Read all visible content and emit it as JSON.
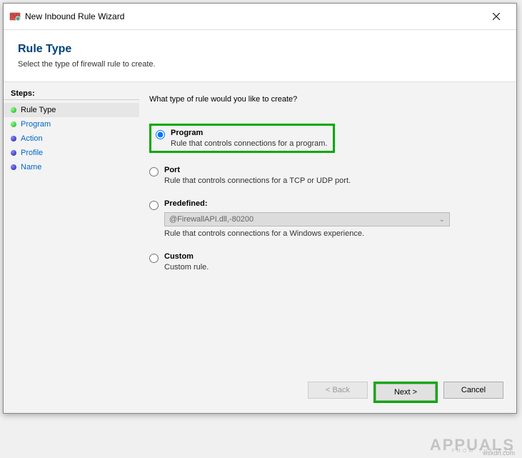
{
  "window": {
    "title": "New Inbound Rule Wizard"
  },
  "header": {
    "title": "Rule Type",
    "subtitle": "Select the type of firewall rule to create."
  },
  "sidebar": {
    "heading": "Steps:",
    "items": [
      {
        "label": "Rule Type",
        "bullet": "green",
        "current": true
      },
      {
        "label": "Program",
        "bullet": "green",
        "current": false,
        "link": true
      },
      {
        "label": "Action",
        "bullet": "blue",
        "current": false,
        "link": true
      },
      {
        "label": "Profile",
        "bullet": "blue",
        "current": false,
        "link": true
      },
      {
        "label": "Name",
        "bullet": "blue",
        "current": false,
        "link": true
      }
    ]
  },
  "content": {
    "prompt": "What type of rule would you like to create?",
    "options": {
      "program": {
        "label": "Program",
        "desc": "Rule that controls connections for a program."
      },
      "port": {
        "label": "Port",
        "desc": "Rule that controls connections for a TCP or UDP port."
      },
      "predefined": {
        "label": "Predefined:",
        "dropdown": "@FirewallAPI.dll,-80200",
        "desc": "Rule that controls connections for a Windows experience."
      },
      "custom": {
        "label": "Custom",
        "desc": "Custom rule."
      }
    }
  },
  "footer": {
    "back": "< Back",
    "next": "Next >",
    "cancel": "Cancel"
  },
  "watermark": {
    "brand": "APPUALS",
    "tag": "FROM THE EXP",
    "site": "wsxdn.com"
  }
}
